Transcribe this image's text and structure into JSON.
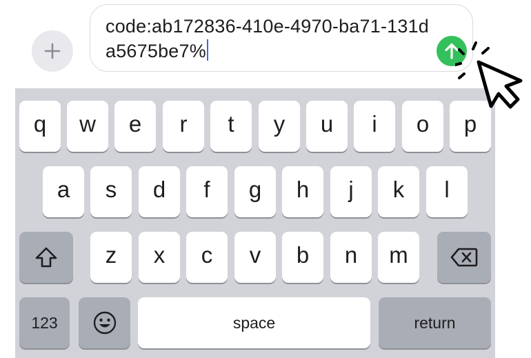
{
  "input": {
    "text": "code:ab172836-410e-4970-ba71-131da5675be7%"
  },
  "icons": {
    "plus": "plus-icon",
    "send": "arrow-up-icon",
    "shift": "shift-arrow-icon",
    "delete": "backspace-icon",
    "emoji": "smiley-icon",
    "pointer": "mouse-pointer-icon"
  },
  "colors": {
    "send_button": "#34c05a",
    "caret": "#2f6bff",
    "keyboard_bg": "#d1d3d9",
    "key_light": "#ffffff",
    "key_dark": "#a9adb6"
  },
  "keyboard": {
    "row1": [
      "q",
      "w",
      "e",
      "r",
      "t",
      "y",
      "u",
      "i",
      "o",
      "p"
    ],
    "row2": [
      "a",
      "s",
      "d",
      "f",
      "g",
      "h",
      "j",
      "k",
      "l"
    ],
    "row3": [
      "z",
      "x",
      "c",
      "v",
      "b",
      "n",
      "m"
    ],
    "numbers_label": "123",
    "space_label": "space",
    "return_label": "return"
  }
}
